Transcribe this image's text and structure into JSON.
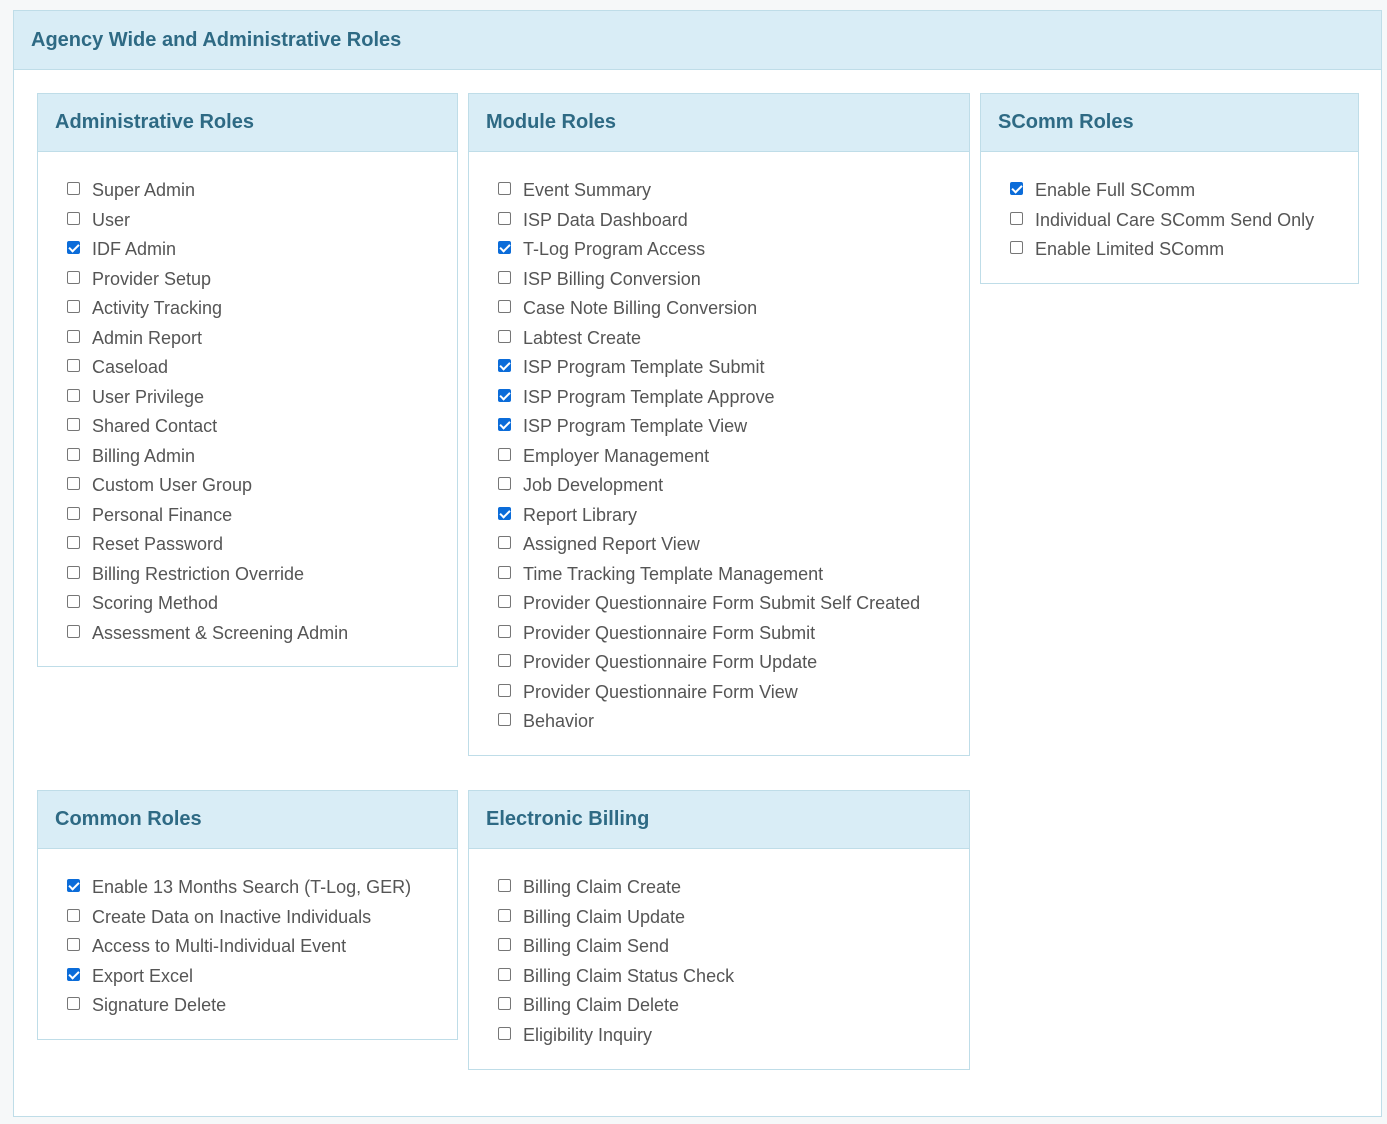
{
  "header": {
    "title": "Agency Wide and Administrative Roles"
  },
  "panels": {
    "admin": {
      "title": "Administrative Roles",
      "items": [
        {
          "label": "Super Admin",
          "checked": false
        },
        {
          "label": "User",
          "checked": false
        },
        {
          "label": "IDF Admin",
          "checked": true
        },
        {
          "label": "Provider Setup",
          "checked": false
        },
        {
          "label": "Activity Tracking",
          "checked": false
        },
        {
          "label": "Admin Report",
          "checked": false
        },
        {
          "label": "Caseload",
          "checked": false
        },
        {
          "label": "User Privilege",
          "checked": false
        },
        {
          "label": "Shared Contact",
          "checked": false
        },
        {
          "label": "Billing Admin",
          "checked": false
        },
        {
          "label": "Custom User Group",
          "checked": false
        },
        {
          "label": "Personal Finance",
          "checked": false
        },
        {
          "label": "Reset Password",
          "checked": false
        },
        {
          "label": "Billing Restriction Override",
          "checked": false
        },
        {
          "label": "Scoring Method",
          "checked": false
        },
        {
          "label": "Assessment & Screening Admin",
          "checked": false
        }
      ]
    },
    "module": {
      "title": "Module Roles",
      "items": [
        {
          "label": "Event Summary",
          "checked": false
        },
        {
          "label": "ISP Data Dashboard",
          "checked": false
        },
        {
          "label": "T-Log Program Access",
          "checked": true
        },
        {
          "label": "ISP Billing Conversion",
          "checked": false
        },
        {
          "label": "Case Note Billing Conversion",
          "checked": false
        },
        {
          "label": "Labtest Create",
          "checked": false
        },
        {
          "label": "ISP Program Template Submit",
          "checked": true
        },
        {
          "label": "ISP Program Template Approve",
          "checked": true
        },
        {
          "label": "ISP Program Template View",
          "checked": true
        },
        {
          "label": "Employer Management",
          "checked": false
        },
        {
          "label": "Job Development",
          "checked": false
        },
        {
          "label": "Report Library",
          "checked": true
        },
        {
          "label": "Assigned Report View",
          "checked": false
        },
        {
          "label": "Time Tracking Template Management",
          "checked": false
        },
        {
          "label": "Provider Questionnaire Form Submit Self Created",
          "checked": false
        },
        {
          "label": "Provider Questionnaire Form Submit",
          "checked": false
        },
        {
          "label": "Provider Questionnaire Form Update",
          "checked": false
        },
        {
          "label": "Provider Questionnaire Form View",
          "checked": false
        },
        {
          "label": "Behavior",
          "checked": false
        }
      ]
    },
    "scomm": {
      "title": "SComm Roles",
      "items": [
        {
          "label": "Enable Full SComm",
          "checked": true
        },
        {
          "label": "Individual Care SComm Send Only",
          "checked": false
        },
        {
          "label": "Enable Limited SComm",
          "checked": false
        }
      ]
    },
    "common": {
      "title": "Common Roles",
      "items": [
        {
          "label": "Enable 13 Months Search (T-Log, GER)",
          "checked": true
        },
        {
          "label": "Create Data on Inactive Individuals",
          "checked": false
        },
        {
          "label": "Access to Multi-Individual Event",
          "checked": false
        },
        {
          "label": "Export Excel",
          "checked": true
        },
        {
          "label": "Signature Delete",
          "checked": false
        }
      ]
    },
    "ebill": {
      "title": "Electronic Billing",
      "items": [
        {
          "label": "Billing Claim Create",
          "checked": false
        },
        {
          "label": "Billing Claim Update",
          "checked": false
        },
        {
          "label": "Billing Claim Send",
          "checked": false
        },
        {
          "label": "Billing Claim Status Check",
          "checked": false
        },
        {
          "label": "Billing Claim Delete",
          "checked": false
        },
        {
          "label": "Eligibility Inquiry",
          "checked": false
        }
      ]
    }
  },
  "colors": {
    "header_bg": "#d9edf6",
    "header_text": "#2e6a84",
    "check_accent": "#0b6cd9"
  }
}
